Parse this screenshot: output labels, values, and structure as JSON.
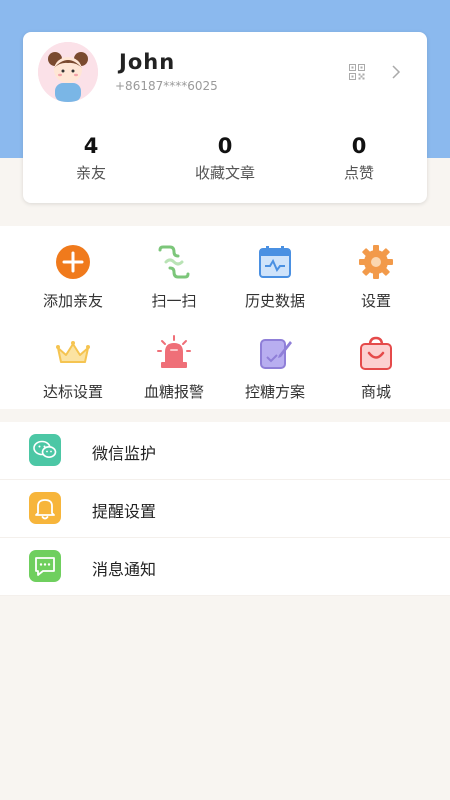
{
  "profile": {
    "name": "John",
    "phone": "+86187****6025",
    "stats": [
      {
        "value": "4",
        "label": "亲友"
      },
      {
        "value": "0",
        "label": "收藏文章"
      },
      {
        "value": "0",
        "label": "点赞"
      }
    ]
  },
  "grid": [
    {
      "label": "添加亲友",
      "icon": "plus-icon",
      "color": "#f07a1c"
    },
    {
      "label": "扫一扫",
      "icon": "scan-icon",
      "color": "#7cc67a"
    },
    {
      "label": "历史数据",
      "icon": "history-data-icon",
      "color": "#4a90e2"
    },
    {
      "label": "设置",
      "icon": "gear-icon",
      "color": "#f29a4a"
    },
    {
      "label": "达标设置",
      "icon": "crown-icon",
      "color": "#f5c451"
    },
    {
      "label": "血糖报警",
      "icon": "alarm-icon",
      "color": "#ef6f78"
    },
    {
      "label": "控糖方案",
      "icon": "plan-edit-icon",
      "color": "#8f7fd8"
    },
    {
      "label": "商城",
      "icon": "shopping-bag-icon",
      "color": "#e54a4a"
    }
  ],
  "list": [
    {
      "label": "微信监护",
      "icon": "wechat-icon",
      "color": "#4cc7a5"
    },
    {
      "label": "提醒设置",
      "icon": "bell-icon",
      "color": "#f7b53b"
    },
    {
      "label": "消息通知",
      "icon": "message-icon",
      "color": "#6fcf5e"
    }
  ],
  "colors": {
    "header_bg": "#8bb9ee",
    "page_bg": "#f8f5f1"
  }
}
